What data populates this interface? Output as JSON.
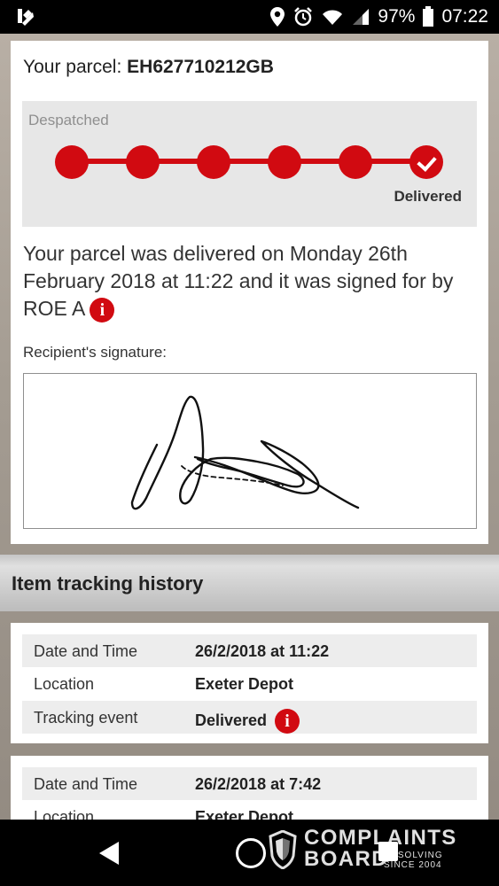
{
  "status_bar": {
    "left_icon": "delivery-app-icon",
    "icons": [
      "location-icon",
      "alarm-icon",
      "wifi-icon",
      "signal-icon"
    ],
    "battery_percent": "97%",
    "battery_level": 0.97,
    "time": "07:22"
  },
  "parcel": {
    "prefix": "Your parcel:",
    "id": "EH627710212GB",
    "progress": {
      "despatched_label": "Despatched",
      "steps_total": 6,
      "steps_complete": 6,
      "delivered_label": "Delivered"
    },
    "delivery_message": "Your parcel was delivered on Monday 26th February 2018 at 11:22 and it was signed for by ROE A",
    "signature_label": "Recipient's signature:"
  },
  "history": {
    "title": "Item tracking history",
    "cards": [
      {
        "rows": [
          {
            "label": "Date and Time",
            "value": "26/2/2018 at 11:22"
          },
          {
            "label": "Location",
            "value": "Exeter Depot"
          },
          {
            "label": "Tracking event",
            "value": "Delivered",
            "info": true
          }
        ]
      },
      {
        "rows": [
          {
            "label": "Date and Time",
            "value": "26/2/2018 at 7:42"
          },
          {
            "label": "Location",
            "value": "Exeter Depot"
          }
        ]
      }
    ]
  },
  "watermark": {
    "line1": "COMPLAINTS",
    "line2": "BOARD",
    "tag1": "RESOLVING",
    "tag2": "SINCE 2004"
  },
  "colors": {
    "brand_red": "#d10a11",
    "row_shade": "#ededed",
    "tracker_background": "#e7e7e7"
  }
}
